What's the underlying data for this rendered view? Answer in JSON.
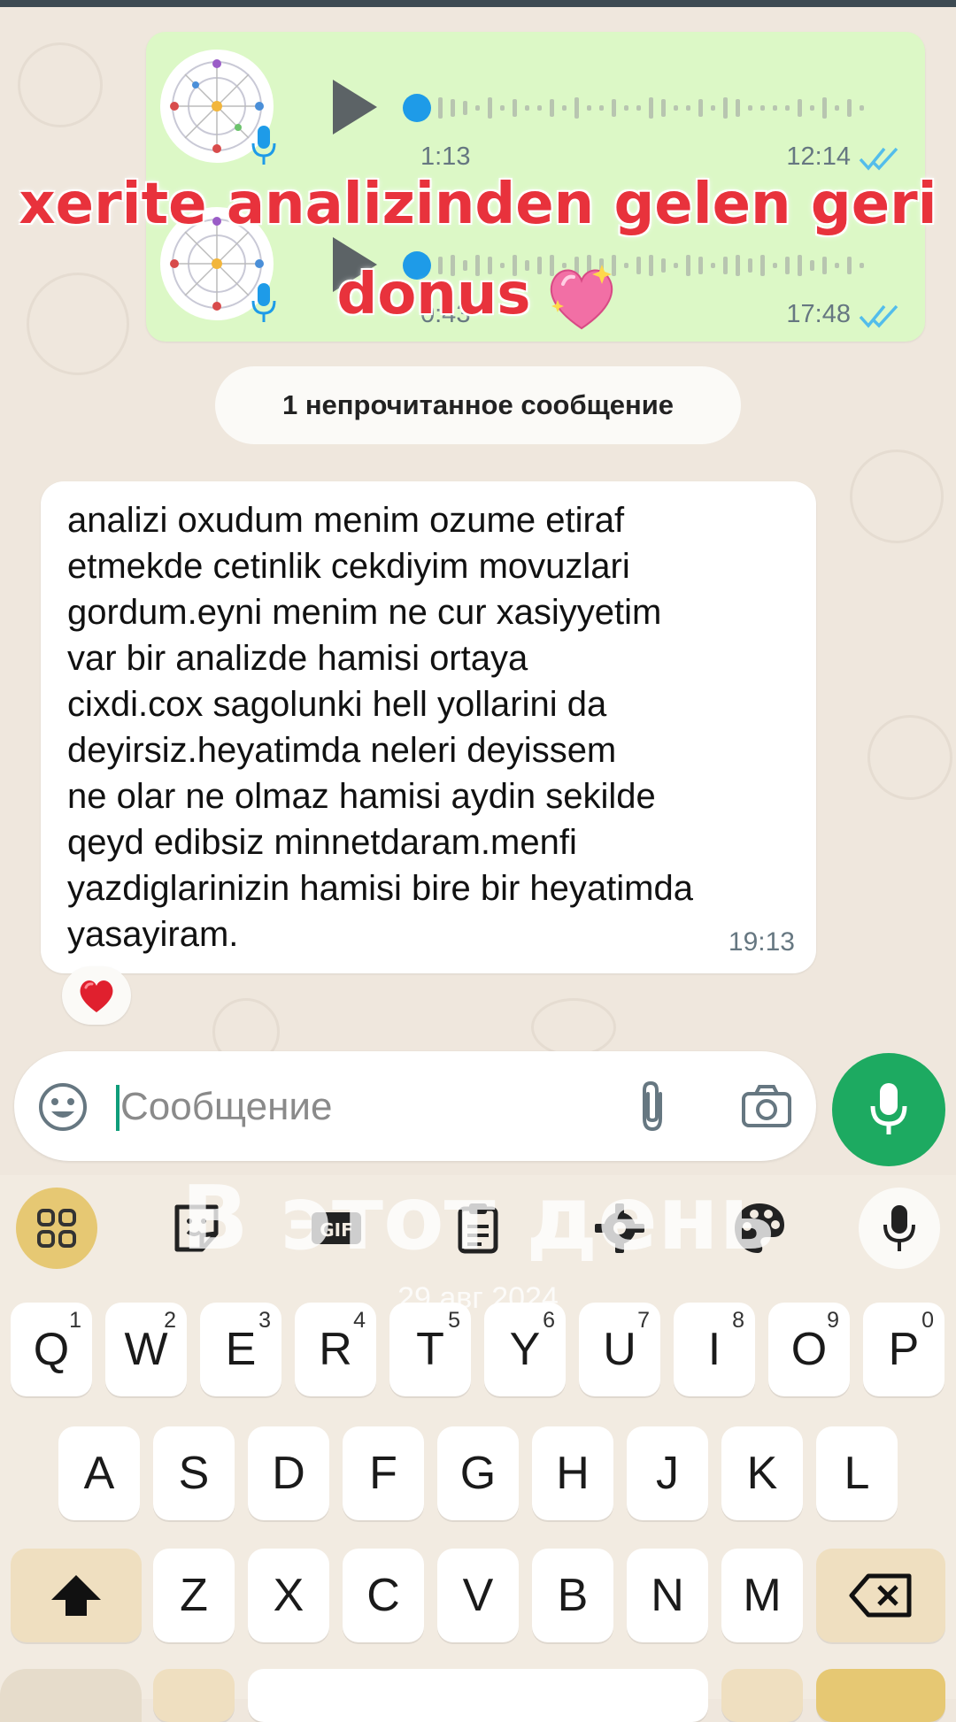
{
  "voice_messages": [
    {
      "duration": "1:13",
      "time": "12:14"
    },
    {
      "duration": "0:43",
      "time": "17:48"
    }
  ],
  "caption": {
    "line1": "xerite analizinden gelen geri",
    "line2": "donus"
  },
  "unread_banner": "1 непрочитанное сообщение",
  "message": {
    "lines": [
      "analizi oxudum menim ozume etiraf",
      "etmekde cetinlik cekdiyim movuzlari",
      "gordum.eyni menim ne cur xasiyyetim",
      "var bir analizde hamisi ortaya",
      "cixdi.cox sagolunki hell yollarini da",
      "deyirsiz.heyatimda neleri deyissem",
      "ne olar ne olmaz hamisi aydin sekilde",
      "qeyd edibsiz minnetdaram.menfi",
      "yazdiglarinizin hamisi bire bir heyatimda",
      "yasayiram."
    ],
    "time": "19:13",
    "reaction": "❤️"
  },
  "composer": {
    "placeholder": "Сообщение"
  },
  "watermark": {
    "title": "В этот день",
    "date": "29 авг 2024"
  },
  "keyboard": {
    "row1": [
      {
        "k": "Q",
        "h": "1"
      },
      {
        "k": "W",
        "h": "2"
      },
      {
        "k": "E",
        "h": "3"
      },
      {
        "k": "R",
        "h": "4"
      },
      {
        "k": "T",
        "h": "5"
      },
      {
        "k": "Y",
        "h": "6"
      },
      {
        "k": "U",
        "h": "7"
      },
      {
        "k": "I",
        "h": "8"
      },
      {
        "k": "O",
        "h": "9"
      },
      {
        "k": "P",
        "h": "0"
      }
    ],
    "row2": [
      "A",
      "S",
      "D",
      "F",
      "G",
      "H",
      "J",
      "K",
      "L"
    ],
    "row3": [
      "Z",
      "X",
      "C",
      "V",
      "B",
      "N",
      "M"
    ]
  },
  "colors": {
    "accent": "#1daa61",
    "caption": "#e8323c",
    "outgoing": "#dcf8c6",
    "ticks": "#53bdeb"
  }
}
